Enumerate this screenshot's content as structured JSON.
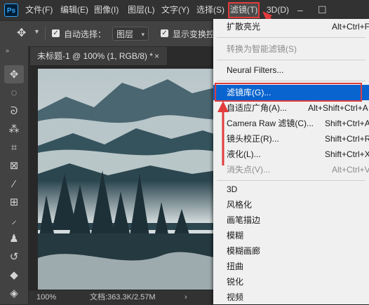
{
  "app": {
    "logo": "Ps"
  },
  "menubar": {
    "items": [
      "文件(F)",
      "编辑(E)",
      "图像(I)",
      "图层(L)",
      "文字(Y)",
      "选择(S)",
      "滤镜(T)",
      "3D(D)"
    ],
    "window_controls": [
      "minimize-icon",
      "maximize-icon"
    ]
  },
  "options_bar": {
    "auto_select_label": "自动选择：",
    "auto_select_value": "图层",
    "show_transform_label": "显示变换控"
  },
  "document": {
    "tab_title": "未标题-1 @ 100% (1, RGB/8) *",
    "tab_close": "×"
  },
  "status_bar": {
    "zoom": "100%",
    "doc_info": "文档:363.3K/2.57M",
    "arrow": "›"
  },
  "filter_menu": {
    "items": [
      {
        "label": "扩散亮光",
        "shortcut": "Alt+Ctrl+F",
        "disabled": false
      },
      {
        "label": "转换为智能滤镜(S)",
        "shortcut": "",
        "disabled": true
      },
      {
        "label": "Neural Filters...",
        "shortcut": "",
        "disabled": false
      },
      {
        "label": "滤镜库(G)...",
        "shortcut": "",
        "disabled": false,
        "highlighted": true
      },
      {
        "label": "自适应广角(A)...",
        "shortcut": "Alt+Shift+Ctrl+A",
        "disabled": false
      },
      {
        "label": "Camera Raw 滤镜(C)...",
        "shortcut": "Shift+Ctrl+A",
        "disabled": false
      },
      {
        "label": "镜头校正(R)...",
        "shortcut": "Shift+Ctrl+R",
        "disabled": false
      },
      {
        "label": "液化(L)...",
        "shortcut": "Shift+Ctrl+X",
        "disabled": false
      },
      {
        "label": "消失点(V)...",
        "shortcut": "Alt+Ctrl+V",
        "disabled": true
      },
      {
        "label": "3D",
        "shortcut": "",
        "disabled": false
      },
      {
        "label": "风格化",
        "shortcut": "",
        "disabled": false
      },
      {
        "label": "画笔描边",
        "shortcut": "",
        "disabled": false
      },
      {
        "label": "模糊",
        "shortcut": "",
        "disabled": false
      },
      {
        "label": "模糊画廊",
        "shortcut": "",
        "disabled": false
      },
      {
        "label": "扭曲",
        "shortcut": "",
        "disabled": false
      },
      {
        "label": "锐化",
        "shortcut": "",
        "disabled": false
      },
      {
        "label": "视频",
        "shortcut": "",
        "disabled": false
      }
    ]
  },
  "colors": {
    "highlight": "#0a64cf",
    "annotation_red": "#e23c3c",
    "ps_blue": "#31a8ff"
  }
}
